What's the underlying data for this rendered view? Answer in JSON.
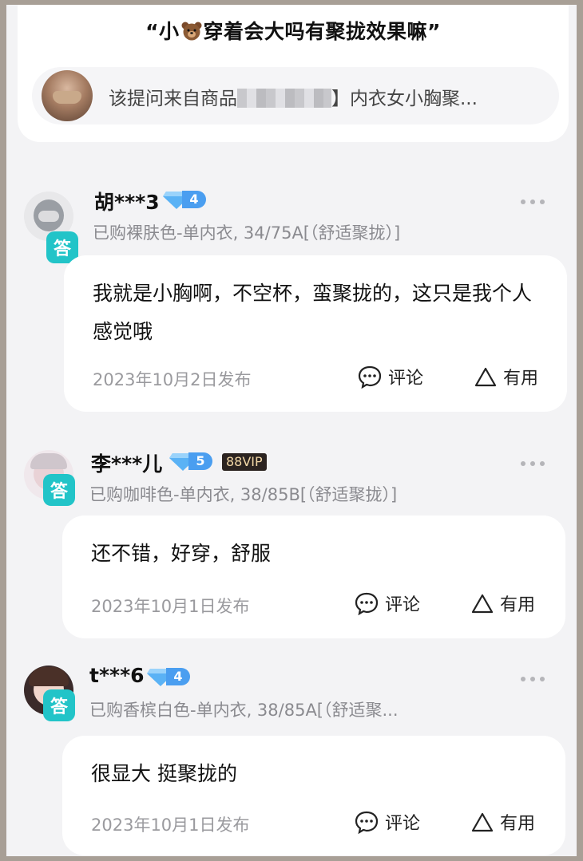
{
  "question": {
    "title_prefix": "“小",
    "title_suffix": "穿着会大吗有聚拢效果嘛”",
    "title_icon": "bear-face-icon",
    "source_prefix": "该提问来自商品",
    "source_suffix": "】内衣女小胸聚..."
  },
  "answer_label": "答",
  "actions": {
    "comment_label": "评论",
    "useful_label": "有用"
  },
  "answers": [
    {
      "username": "胡***3",
      "level": "4",
      "purchase": "已购裸肤色-单内衣, 34/75A[（舒适聚拢）]",
      "text": "我就是小胸啊，不空杯，蛮聚拢的，这只是我个人感觉哦",
      "date": "2023年10月2日发布"
    },
    {
      "username": "李***儿",
      "level": "5",
      "vip": "88VIP",
      "purchase": "已购咖啡色-单内衣, 38/85B[（舒适聚拢）]",
      "text": "还不错，好穿，舒服",
      "date": "2023年10月1日发布"
    },
    {
      "username": "t***6",
      "level": "4",
      "purchase": "已购香槟白色-单内衣, 38/85A[（舒适聚...",
      "text": "很显大 挺聚拢的",
      "date": "2023年10月1日发布"
    }
  ],
  "colors": {
    "answer_badge": "#22c4c8",
    "level_badge": "#4a9ef0",
    "vip_bg": "#2b2320",
    "vip_text": "#f2d7a6"
  }
}
